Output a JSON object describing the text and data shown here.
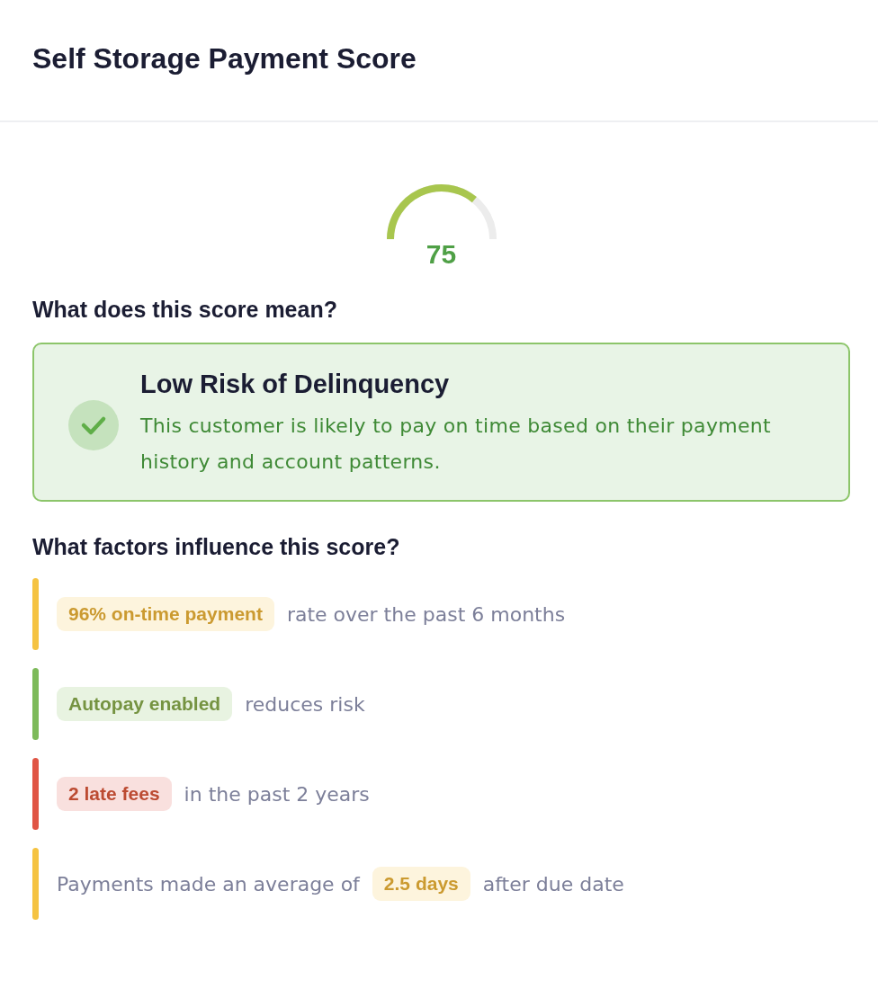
{
  "header": {
    "title": "Self Storage Payment Score"
  },
  "score": {
    "value": "75"
  },
  "meaning": {
    "heading": "What does this score mean?",
    "title": "Low Risk of Delinquency",
    "text": "This customer is likely to pay on time based on their payment history and account patterns."
  },
  "factors": {
    "heading": "What factors influence this score?",
    "items": [
      {
        "color": "#f5c342",
        "parts": [
          {
            "kind": "badge",
            "text": "96% on-time payment"
          },
          {
            "kind": "plain",
            "text": "rate over the past 6 months"
          }
        ]
      },
      {
        "color": "#7dba5a",
        "parts": [
          {
            "kind": "badge",
            "text": "Autopay enabled"
          },
          {
            "kind": "plain",
            "text": "reduces risk"
          }
        ]
      },
      {
        "color": "#e05545",
        "parts": [
          {
            "kind": "badge",
            "text": "2 late fees"
          },
          {
            "kind": "plain",
            "text": "in the past 2 years"
          }
        ]
      },
      {
        "color": "#f5c342",
        "parts": [
          {
            "kind": "plain",
            "text": "Payments made an average of"
          },
          {
            "kind": "badge",
            "text": "2.5 days"
          },
          {
            "kind": "plain",
            "text": "after due date"
          }
        ]
      }
    ]
  }
}
